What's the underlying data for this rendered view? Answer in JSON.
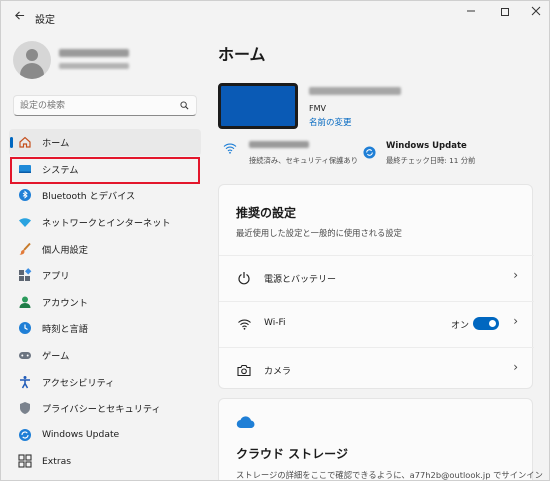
{
  "window": {
    "title": "設定",
    "back_icon": "back-arrow-icon"
  },
  "search": {
    "placeholder": "設定の検索"
  },
  "nav": {
    "items": [
      {
        "label": "ホーム",
        "icon": "home-icon"
      },
      {
        "label": "システム",
        "icon": "system-icon"
      },
      {
        "label": "Bluetooth とデバイス",
        "icon": "bluetooth-icon"
      },
      {
        "label": "ネットワークとインターネット",
        "icon": "network-icon"
      },
      {
        "label": "個人用設定",
        "icon": "brush-icon"
      },
      {
        "label": "アプリ",
        "icon": "apps-icon"
      },
      {
        "label": "アカウント",
        "icon": "account-icon"
      },
      {
        "label": "時刻と言語",
        "icon": "time-language-icon"
      },
      {
        "label": "ゲーム",
        "icon": "gaming-icon"
      },
      {
        "label": "アクセシビリティ",
        "icon": "accessibility-icon"
      },
      {
        "label": "プライバシーとセキュリティ",
        "icon": "shield-icon"
      },
      {
        "label": "Windows Update",
        "icon": "windows-update-icon"
      },
      {
        "label": "Extras",
        "icon": "extras-icon"
      }
    ]
  },
  "main": {
    "title": "ホーム",
    "device": {
      "model": "FMV",
      "rename_label": "名前の変更"
    },
    "wifi": {
      "status": "接続済み、セキュリティ保護あり"
    },
    "windows_update": {
      "title": "Windows Update",
      "status": "最終チェック日時: 11 分前"
    },
    "recommended": {
      "title": "推奨の設定",
      "subtitle": "最近使用した設定と一般的に使用される設定",
      "rows": [
        {
          "label": "電源とバッテリー",
          "icon": "power-icon"
        },
        {
          "label": "Wi-Fi",
          "icon": "wifi-icon",
          "toggle_label": "オン",
          "toggle_on": true
        },
        {
          "label": "カメラ",
          "icon": "camera-icon"
        }
      ]
    },
    "cloud": {
      "title": "クラウド ストレージ",
      "description": "ストレージの詳細をここで確認できるように、a77h2b@outlook.jp でサインイン"
    }
  },
  "colors": {
    "accent": "#0067c0",
    "highlight": "#e3162b",
    "device_screen": "#0a5ab5"
  }
}
